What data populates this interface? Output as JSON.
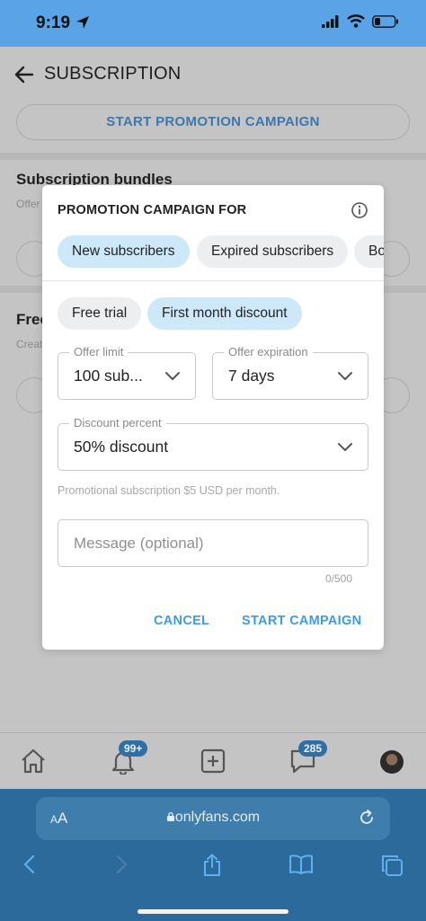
{
  "status_bar": {
    "time": "9:19"
  },
  "app": {
    "title": "SUBSCRIPTION",
    "start_promotion_label": "START PROMOTION CAMPAIGN",
    "bundles_title": "Subscription bundles",
    "bundles_sub": "Offer",
    "free_title": "Free",
    "free_sub": "Creat"
  },
  "modal": {
    "title": "PROMOTION CAMPAIGN FOR",
    "audience_chips": [
      {
        "label": "New subscribers",
        "selected": true
      },
      {
        "label": "Expired subscribers",
        "selected": false
      },
      {
        "label": "Bo",
        "selected": false
      }
    ],
    "type_chips": [
      {
        "label": "Free trial",
        "selected": false
      },
      {
        "label": "First month discount",
        "selected": true
      }
    ],
    "offer_limit": {
      "label": "Offer limit",
      "value": "100 sub..."
    },
    "offer_expiration": {
      "label": "Offer expiration",
      "value": "7 days"
    },
    "discount_percent": {
      "label": "Discount percent",
      "value": "50% discount"
    },
    "hint": "Promotional subscription $5 USD per month.",
    "message_placeholder": "Message (optional)",
    "counter": "0/500",
    "cancel_label": "CANCEL",
    "start_label": "START CAMPAIGN"
  },
  "bottom_nav": {
    "notifications_badge": "99+",
    "messages_badge": "285"
  },
  "safari": {
    "text_size_label": "AA",
    "url": "onlyfans.com"
  },
  "colors": {
    "accent": "#3b9de3",
    "chip_selected": "#cde8f8",
    "safari_bar": "#2d6a9c",
    "status_bar": "#5aa3e6"
  }
}
